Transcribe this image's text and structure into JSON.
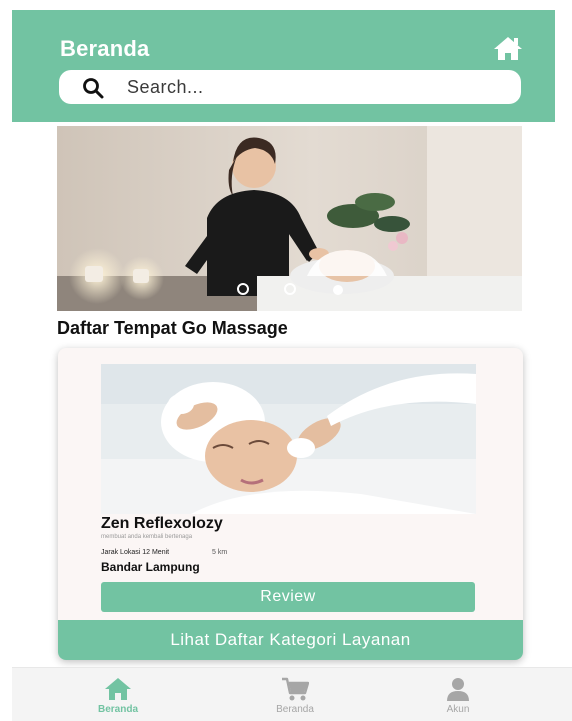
{
  "header": {
    "title": "Beranda",
    "home_icon": "home-icon"
  },
  "search": {
    "placeholder": "Search...",
    "icon": "search-icon"
  },
  "banner": {
    "image": "spa-facial-massage-photo",
    "carousel_dots": {
      "count": 3,
      "active_index": 2
    }
  },
  "section": {
    "title": "Daftar Tempat Go Massage"
  },
  "place_card": {
    "image": "facial-treatment-photo",
    "name": "Zen Reflexolozy",
    "subtitle": "membuat anda kembali bertenaga",
    "distance": "Jarak Lokasi 12 Menit",
    "hours": "5 km",
    "city": "Bandar Lampung",
    "review_label": "Review"
  },
  "category_button": {
    "label": "Lihat Daftar Kategori Layanan"
  },
  "bottom_nav": {
    "items": [
      {
        "label": "Beranda",
        "icon": "home-icon",
        "active": true
      },
      {
        "label": "Beranda",
        "icon": "cart-icon",
        "active": false
      },
      {
        "label": "Akun",
        "icon": "user-icon",
        "active": false
      }
    ]
  },
  "colors": {
    "primary": "#72c3a2",
    "nav_inactive": "#a6a6a6",
    "card_bg": "#fbf6f5"
  }
}
